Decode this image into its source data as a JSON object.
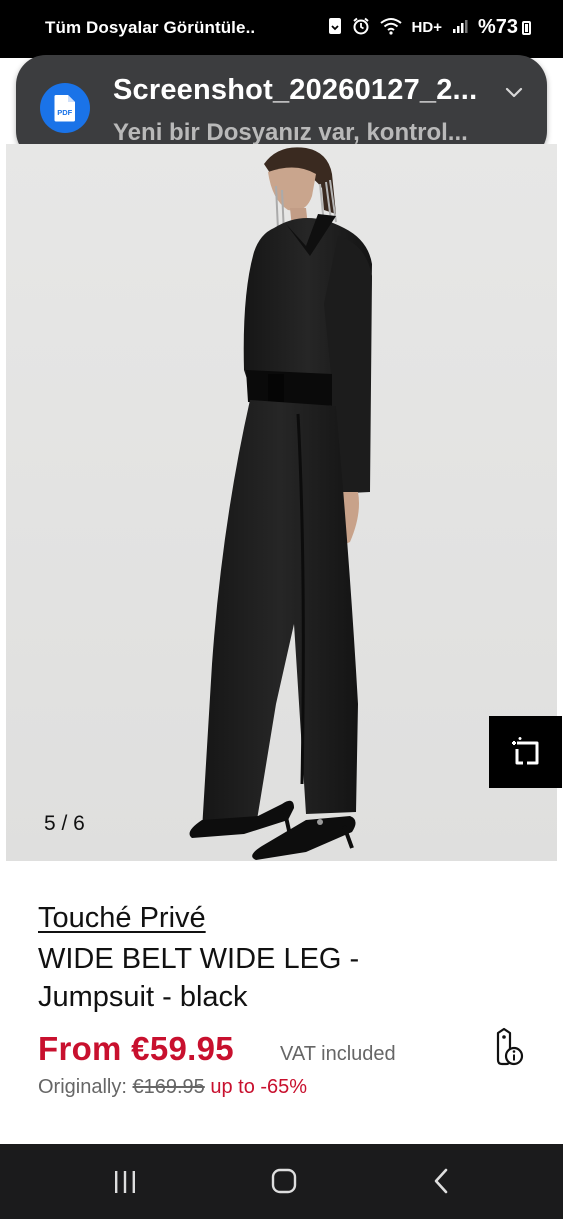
{
  "status_bar": {
    "title": "Tüm Dosyalar Görüntüle..",
    "battery_text": "%73",
    "network_label": "HD+"
  },
  "notification": {
    "title": "Screenshot_20260127_2...",
    "body": "Yeni bir Dosyanız var, kontrol...",
    "file_icon_label": "PDF",
    "icon_name": "pdf-file-icon",
    "accent": "#1a73e8"
  },
  "product": {
    "image_counter": "5 / 6",
    "brand": "Touché Privé",
    "name": "WIDE BELT WIDE LEG - Jumpsuit - black",
    "price": "From €59.95",
    "vat": "VAT included",
    "original_label": "Originally:",
    "original_price": "€169.95",
    "discount": "up to -65%",
    "price_color": "#c8102e"
  },
  "icons": {
    "zoom": "expand-crop-icon",
    "tag_info": "price-tag-info-icon",
    "nav_recents": "recent-apps-icon",
    "nav_home": "home-icon",
    "nav_back": "back-icon"
  }
}
